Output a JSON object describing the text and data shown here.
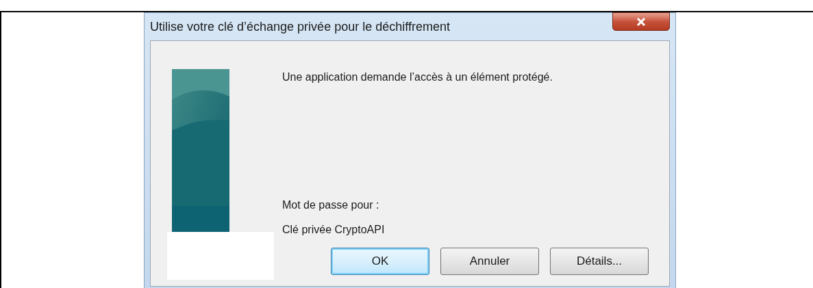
{
  "window": {
    "title": "Utilise votre clé d’échange privée pour le déchiffrement"
  },
  "message": "Une application demande l’accès à un élément protégé.",
  "password_label": "Mot de passe pour :",
  "key_name": "Clé privée CryptoAPI",
  "buttons": [
    {
      "label": "OK",
      "default": true
    },
    {
      "label": "Annuler",
      "default": false
    },
    {
      "label": "Détails...",
      "default": false
    }
  ]
}
